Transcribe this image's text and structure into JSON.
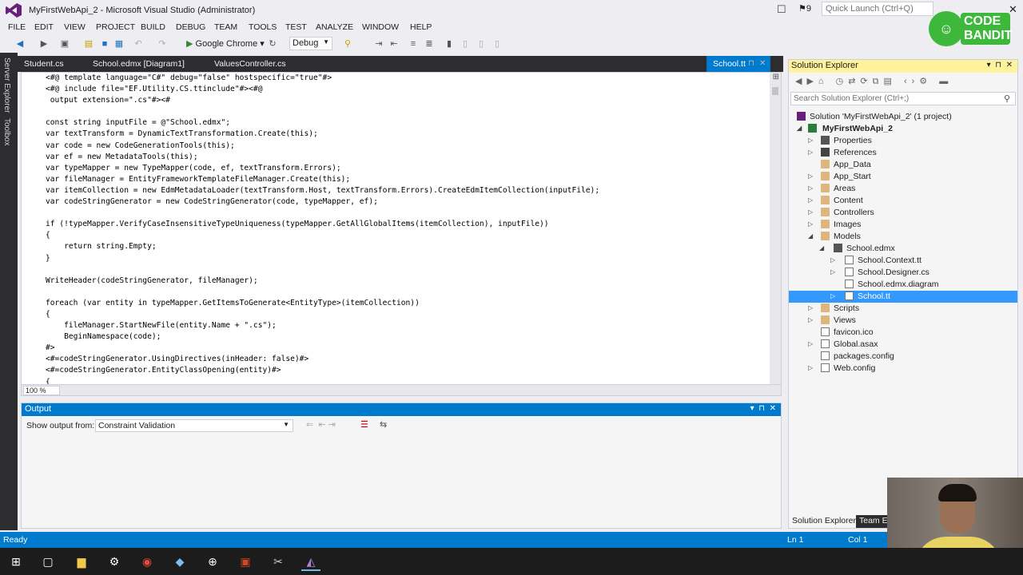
{
  "window": {
    "title": "MyFirstWebApi_2 - Microsoft Visual Studio (Administrator)",
    "notifications": "9",
    "quick_launch_placeholder": "Quick Launch (Ctrl+Q)"
  },
  "logo": {
    "text_line1": "CODE",
    "text_line2": "BANDIT"
  },
  "menu": [
    "FILE",
    "EDIT",
    "VIEW",
    "PROJECT",
    "BUILD",
    "DEBUG",
    "TEAM",
    "TOOLS",
    "TEST",
    "ANALYZE",
    "WINDOW",
    "HELP"
  ],
  "toolbar": {
    "run_label": "Google Chrome",
    "config_label": "Debug"
  },
  "left_strip": {
    "server_explorer": "Server Explorer",
    "toolbox": "Toolbox"
  },
  "editor_tabs": {
    "tab1": "Student.cs",
    "tab2": "School.edmx [Diagram1]",
    "tab3": "ValuesController.cs",
    "active": "School.tt"
  },
  "code_lines": [
    "<#@ template language=\"C#\" debug=\"false\" hostspecific=\"true\"#>",
    "<#@ include file=\"EF.Utility.CS.ttinclude\"#><#@",
    " output extension=\".cs\"#><#",
    "",
    "const string inputFile = @\"School.edmx\";",
    "var textTransform = DynamicTextTransformation.Create(this);",
    "var code = new CodeGenerationTools(this);",
    "var ef = new MetadataTools(this);",
    "var typeMapper = new TypeMapper(code, ef, textTransform.Errors);",
    "var fileManager = EntityFrameworkTemplateFileManager.Create(this);",
    "var itemCollection = new EdmMetadataLoader(textTransform.Host, textTransform.Errors).CreateEdmItemCollection(inputFile);",
    "var codeStringGenerator = new CodeStringGenerator(code, typeMapper, ef);",
    "",
    "if (!typeMapper.VerifyCaseInsensitiveTypeUniqueness(typeMapper.GetAllGlobalItems(itemCollection), inputFile))",
    "{",
    "    return string.Empty;",
    "}",
    "",
    "WriteHeader(codeStringGenerator, fileManager);",
    "",
    "foreach (var entity in typeMapper.GetItemsToGenerate<EntityType>(itemCollection))",
    "{",
    "    fileManager.StartNewFile(entity.Name + \".cs\");",
    "    BeginNamespace(code);",
    "#>",
    "<#=codeStringGenerator.UsingDirectives(inHeader: false)#>",
    "<#=codeStringGenerator.EntityClassOpening(entity)#>",
    "{"
  ],
  "editor": {
    "zoom": "100 %"
  },
  "output": {
    "title": "Output",
    "show_from_label": "Show output from:",
    "show_from_value": "Constraint Validation"
  },
  "solution_explorer": {
    "title": "Solution Explorer",
    "search_placeholder": "Search Solution Explorer (Ctrl+;)",
    "items": {
      "solution": "Solution 'MyFirstWebApi_2' (1 project)",
      "project": "MyFirstWebApi_2",
      "properties": "Properties",
      "references": "References",
      "app_data": "App_Data",
      "app_start": "App_Start",
      "areas": "Areas",
      "content": "Content",
      "controllers": "Controllers",
      "images": "Images",
      "models": "Models",
      "school_edmx": "School.edmx",
      "school_context": "School.Context.tt",
      "school_designer": "School.Designer.cs",
      "school_diagram": "School.edmx.diagram",
      "school_tt": "School.tt",
      "scripts": "Scripts",
      "views": "Views",
      "favicon": "favicon.ico",
      "global": "Global.asax",
      "packages": "packages.config",
      "webconfig": "Web.config"
    },
    "bottom_tabs": {
      "tab1": "Solution Explorer",
      "tab2": "Team Ex"
    }
  },
  "status": {
    "ready": "Ready",
    "line": "Ln 1",
    "col": "Col 1"
  }
}
